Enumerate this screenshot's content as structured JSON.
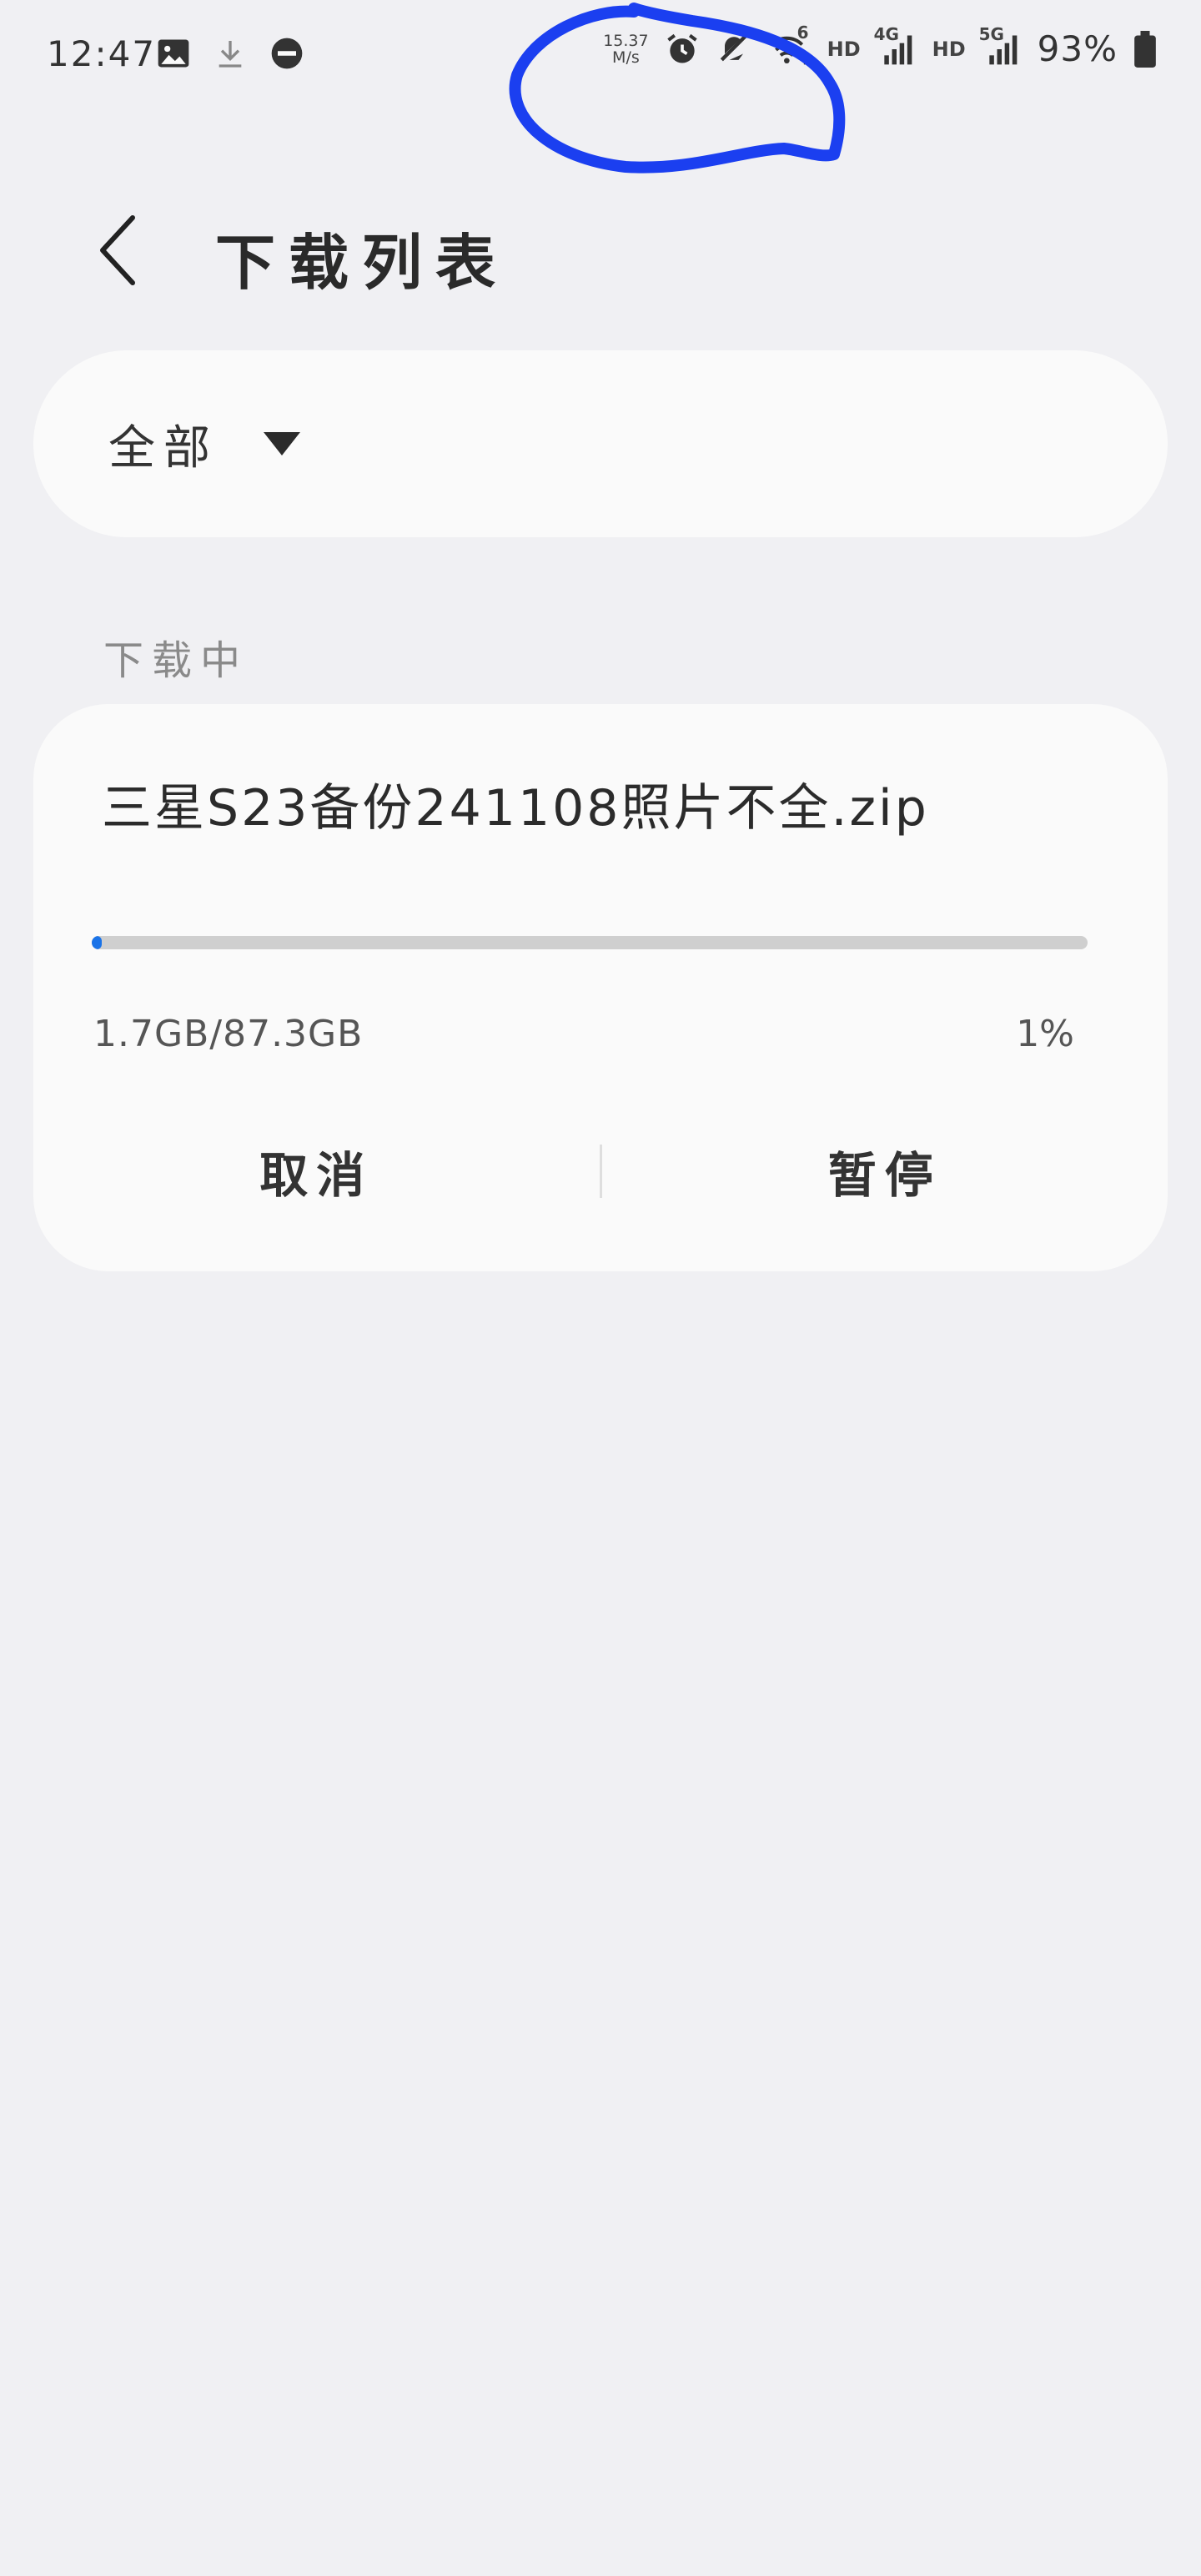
{
  "status_bar": {
    "time": "12:47",
    "speed_value": "15.37",
    "speed_unit": "M/s",
    "hd_label_1": "HD",
    "hd_label_2": "HD",
    "net_1": "4G",
    "net_2": "5G",
    "wifi_label": "6",
    "battery_percent": "93%",
    "icons": [
      "image-icon",
      "download-icon",
      "do-not-disturb-icon",
      "alarm-icon",
      "mute-icon",
      "wifi-icon",
      "signal-icon",
      "battery-icon"
    ]
  },
  "header": {
    "title": "下载列表"
  },
  "filter": {
    "selected": "全部"
  },
  "section": {
    "title": "下载中"
  },
  "download": {
    "file_name": "三星S23备份241108照片不全.zip",
    "size_text": "1.7GB/87.3GB",
    "percent_text": "1%",
    "progress_fraction": 0.01,
    "cancel_label": "取消",
    "pause_label": "暂停"
  },
  "colors": {
    "background": "#f0f0f3",
    "card": "#fafafa",
    "progress": "#1a73e8",
    "annotation": "#1b3ff0"
  }
}
